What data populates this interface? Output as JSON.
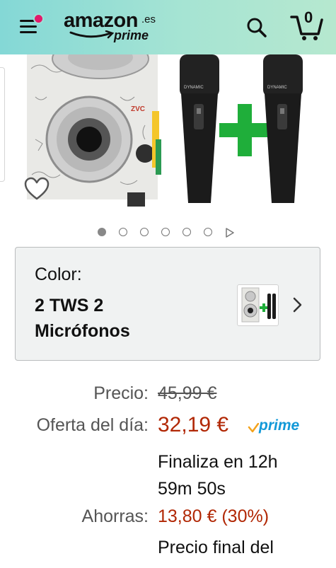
{
  "header": {
    "logo_word": "amazon",
    "logo_tld": ".es",
    "logo_sub": "prime",
    "cart_count": "0",
    "icons": [
      "menu-icon",
      "search-icon",
      "cart-icon"
    ],
    "colors": {
      "header_bg": "#9fe0d6",
      "notification_dot": "#e3196b"
    }
  },
  "carousel": {
    "image_count": 6,
    "active_index": 0,
    "has_video": true
  },
  "variation": {
    "label": "Color:",
    "value": "2 TWS 2 Micrófonos"
  },
  "pricing": {
    "list_label": "Precio:",
    "list_price": "45,99 €",
    "deal_label": "Oferta del día:",
    "deal_price": "32,19 €",
    "prime_badge": "prime",
    "deal_ends": "Finaliza en 12h 59m 50s",
    "saving_label": "Ahorras:",
    "saving_value": "13,80 € (30%)",
    "final_price_note": "Precio final del",
    "price_color": "#b12704",
    "prime_color": "#1399d8"
  }
}
